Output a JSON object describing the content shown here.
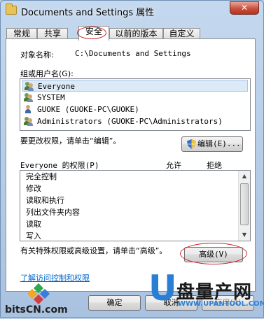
{
  "window": {
    "title": "Documents and Settings 属性",
    "close_glyph": "✕"
  },
  "tabs": [
    {
      "label": "常规"
    },
    {
      "label": "共享"
    },
    {
      "label": "安全",
      "active": true
    },
    {
      "label": "以前的版本"
    },
    {
      "label": "自定义"
    }
  ],
  "security": {
    "object_name_label": "对象名称:",
    "object_name_value": "C:\\Documents and Settings",
    "group_label": "组或用户名(G):",
    "users": [
      {
        "name": "Everyone",
        "icon": "group-icon",
        "selected": true
      },
      {
        "name": "SYSTEM",
        "icon": "group-icon"
      },
      {
        "name": "GUOKE (GUOKE-PC\\GUOKE)",
        "icon": "user-icon"
      },
      {
        "name": "Administrators (GUOKE-PC\\Administrators)",
        "icon": "group-icon"
      }
    ],
    "change_perm_text": "要更改权限，请单击“编辑”。",
    "edit_button": "编辑(E)...",
    "perm_for": "Everyone 的权限(P)",
    "allow_header": "允许",
    "deny_header": "拒绝",
    "permissions": [
      "完全控制",
      "修改",
      "读取和执行",
      "列出文件夹内容",
      "读取",
      "写入"
    ],
    "advanced_text": "有关特殊权限或高级设置，请单击“高级”。",
    "advanced_button": "高级(V)",
    "learn_link": "了解访问控制和权限"
  },
  "footer": {
    "ok_button": "确定",
    "cancel_button": "取消",
    "apply_button": "应用(A)"
  },
  "watermarks": {
    "bits_text": "bitsCN.com",
    "upan_big": "盘量产网",
    "upan_url": "WWW.UPANTOOL.COM",
    "upan_letter": "U"
  },
  "colors": {
    "accent_red": "#c8232c",
    "link_blue": "#0066cc",
    "selection": "#dceaf8"
  }
}
